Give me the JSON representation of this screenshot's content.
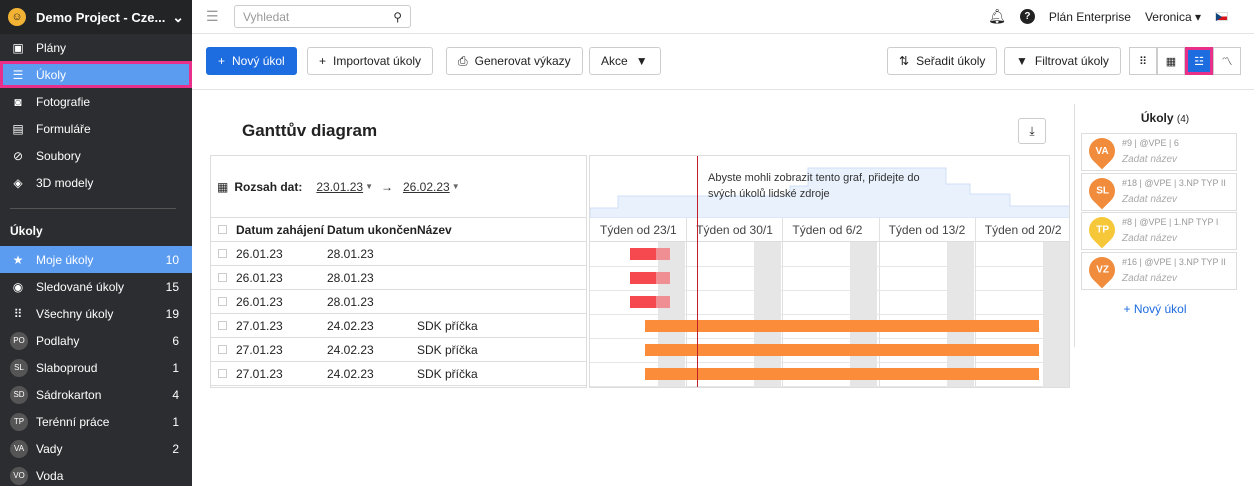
{
  "sidebar": {
    "project": "Demo Project - Cze...",
    "nav": [
      {
        "label": "Plány",
        "icon": "plans-icon"
      },
      {
        "label": "Úkoly",
        "icon": "list-icon"
      },
      {
        "label": "Fotografie",
        "icon": "camera-icon"
      },
      {
        "label": "Formuláře",
        "icon": "form-icon"
      },
      {
        "label": "Soubory",
        "icon": "paperclip-icon"
      },
      {
        "label": "3D modely",
        "icon": "cube-icon"
      }
    ],
    "tasks_heading": "Úkoly",
    "tasks": [
      {
        "label": "Moje úkoly",
        "count": "10",
        "icon": "star-icon"
      },
      {
        "label": "Sledované úkoly",
        "count": "15",
        "icon": "eye-icon"
      },
      {
        "label": "Všechny úkoly",
        "count": "19",
        "icon": "grid-icon"
      },
      {
        "label": "Podlahy",
        "count": "6",
        "badge": "PO"
      },
      {
        "label": "Slaboproud",
        "count": "1",
        "badge": "SL"
      },
      {
        "label": "Sádrokarton",
        "count": "4",
        "badge": "SD"
      },
      {
        "label": "Terénní práce",
        "count": "1",
        "badge": "TP"
      },
      {
        "label": "Vady",
        "count": "2",
        "badge": "VA"
      },
      {
        "label": "Voda",
        "count": "",
        "badge": "VO"
      }
    ]
  },
  "topbar": {
    "search_placeholder": "Vyhledat",
    "plan": "Plán Enterprise",
    "user": "Veronica"
  },
  "toolbar": {
    "new_task": "Nový úkol",
    "import": "Importovat úkoly",
    "reports": "Generovat výkazy",
    "actions": "Akce",
    "sort": "Seřadit úkoly",
    "filter": "Filtrovat úkoly"
  },
  "gantt": {
    "title": "Ganttův diagram",
    "range_label": "Rozsah dat:",
    "range_from": "23.01.23",
    "range_to": "26.02.23",
    "columns": [
      "Datum zahájení",
      "Datum ukončení",
      "Název"
    ],
    "rows": [
      {
        "start": "26.01.23",
        "end": "28.01.23",
        "name": ""
      },
      {
        "start": "26.01.23",
        "end": "28.01.23",
        "name": ""
      },
      {
        "start": "26.01.23",
        "end": "28.01.23",
        "name": ""
      },
      {
        "start": "27.01.23",
        "end": "24.02.23",
        "name": "SDK příčka"
      },
      {
        "start": "27.01.23",
        "end": "24.02.23",
        "name": "SDK příčka"
      },
      {
        "start": "27.01.23",
        "end": "24.02.23",
        "name": "SDK příčka"
      }
    ],
    "message": "Abyste mohli zobrazit tento graf, přidejte do svých úkolů lidské zdroje",
    "weeks": [
      "Týden od 23/1",
      "Týden od 30/1",
      "Týden od 6/2",
      "Týden od 13/2",
      "Týden od 20/2"
    ],
    "colors": {
      "red": "#f5494f",
      "orange": "#fb8c3a",
      "today": "#c0202a"
    }
  },
  "right_panel": {
    "title": "Úkoly",
    "count": "(4)",
    "cards": [
      {
        "badge": "VA",
        "info": "#9 | @VPE | 6",
        "name": "Zadat název",
        "color": "#f08c3c"
      },
      {
        "badge": "SL",
        "info": "#18 | @VPE | 3.NP TYP II",
        "name": "Zadat název",
        "color": "#f08c3c"
      },
      {
        "badge": "TP",
        "info": "#8 | @VPE | 1.NP TYP I",
        "name": "Zadat název",
        "color": "#f7c73a"
      },
      {
        "badge": "VZ",
        "info": "#16 | @VPE | 3.NP TYP II",
        "name": "Zadat název",
        "color": "#f08c3c"
      }
    ],
    "new_task": "+ Nový úkol"
  }
}
